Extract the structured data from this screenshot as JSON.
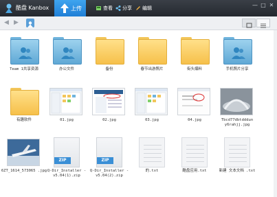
{
  "app": {
    "name": "酷盘 Kanbox"
  },
  "toolbar": {
    "upload": "上传",
    "view": "查看",
    "share": "分享",
    "edit": "编辑"
  },
  "window": {
    "minimize": "—",
    "maximize": "□",
    "close": "✕"
  },
  "files": [
    {
      "name": "Team 1共享资源",
      "kind": "folder-blue"
    },
    {
      "name": "办公文件",
      "kind": "folder-blue"
    },
    {
      "name": "备份",
      "kind": "folder"
    },
    {
      "name": "春节出游照片",
      "kind": "folder"
    },
    {
      "name": "街头爆料",
      "kind": "folder"
    },
    {
      "name": "手机照片分享",
      "kind": "folder-blue"
    },
    {
      "name": "有趣软件",
      "kind": "folder"
    },
    {
      "name": "01.jpg",
      "kind": "screenshot"
    },
    {
      "name": "02.jpg",
      "kind": "screenshot2"
    },
    {
      "name": "03.jpg",
      "kind": "screenshot"
    },
    {
      "name": "04.jpg",
      "kind": "webpage"
    },
    {
      "name": "Tbcd77dbtdddun y6rahjj.jpg",
      "kind": "photo-gray"
    },
    {
      "name": "6ZT_1614_573065 .jpg",
      "kind": "photo-plane"
    },
    {
      "name": "Q-Dir_Installer -v5.04(1).zip",
      "kind": "zip"
    },
    {
      "name": "Q-Dir_Installer -v5.04(2).zip",
      "kind": "zip"
    },
    {
      "name": "的.txt",
      "kind": "txt"
    },
    {
      "name": "酷盘应用.txt",
      "kind": "txt"
    },
    {
      "name": "新建 文本文档 .txt",
      "kind": "txt"
    }
  ],
  "zip_label": "ZIP"
}
